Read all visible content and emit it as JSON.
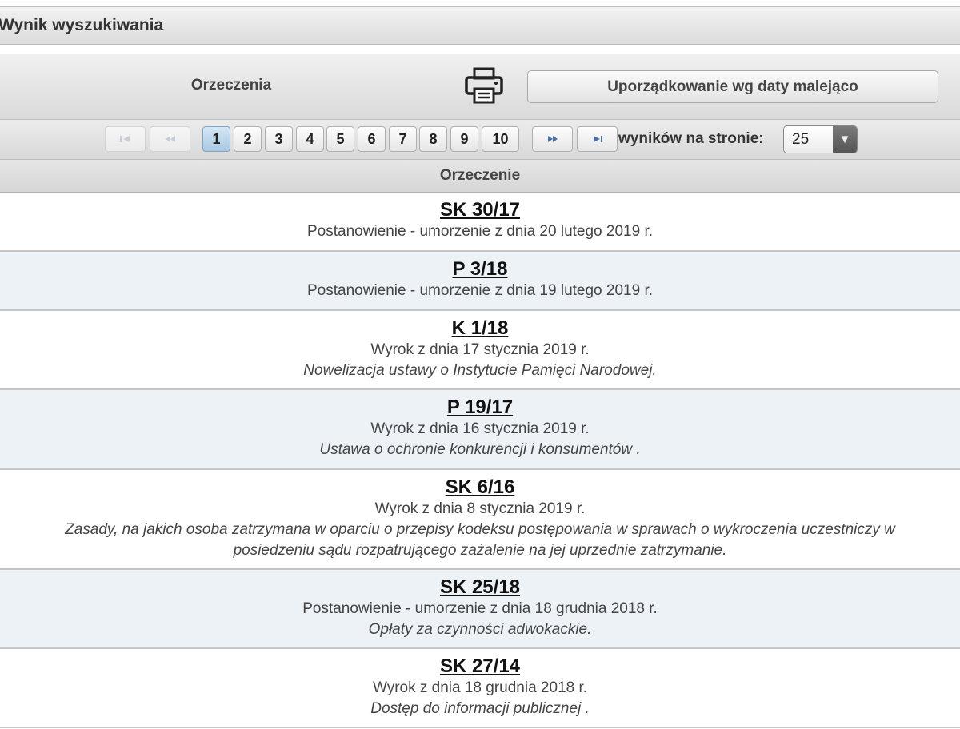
{
  "header": {
    "title": "Wynik wyszukiwania"
  },
  "toolbar": {
    "section_label": "Orzeczenia",
    "print_icon": "printer-icon",
    "sort_label": "Uporządkowanie wg daty malejąco"
  },
  "pager": {
    "pages": [
      "1",
      "2",
      "3",
      "4",
      "5",
      "6",
      "7",
      "8",
      "9",
      "10"
    ],
    "current_page": "1",
    "first_icon": "first-page-icon",
    "prev_icon": "previous-page-icon",
    "next_icon": "next-page-icon",
    "last_icon": "last-page-icon",
    "per_page_label": "wyników na stronie:",
    "per_page_value": "25"
  },
  "table": {
    "column_header": "Orzeczenie",
    "rows": [
      {
        "signature": "SK 30/17",
        "description": "Postanowienie - umorzenie z dnia 20 lutego 2019 r.",
        "subject": ""
      },
      {
        "signature": "P 3/18",
        "description": "Postanowienie - umorzenie z dnia 19 lutego 2019 r.",
        "subject": ""
      },
      {
        "signature": "K 1/18",
        "description": "Wyrok z dnia 17 stycznia 2019 r.",
        "subject": "Nowelizacja ustawy o Instytucie Pamięci Narodowej."
      },
      {
        "signature": "P 19/17",
        "description": "Wyrok z dnia 16 stycznia 2019 r.",
        "subject": "Ustawa o ochronie konkurencji i konsumentów ."
      },
      {
        "signature": "SK 6/16",
        "description": "Wyrok z dnia 8 stycznia 2019 r.",
        "subject": "Zasady, na jakich osoba zatrzymana w oparciu o przepisy kodeksu postępowania w sprawach o wykroczenia uczestniczy w posiedzeniu sądu rozpatrującego zażalenie na jej uprzednie zatrzymanie."
      },
      {
        "signature": "SK 25/18",
        "description": "Postanowienie - umorzenie z dnia 18 grudnia 2018 r.",
        "subject": "Opłaty za czynności adwokackie."
      },
      {
        "signature": "SK 27/14",
        "description": "Wyrok z dnia 18 grudnia 2018 r.",
        "subject": "Dostęp do informacji publicznej ."
      }
    ]
  }
}
